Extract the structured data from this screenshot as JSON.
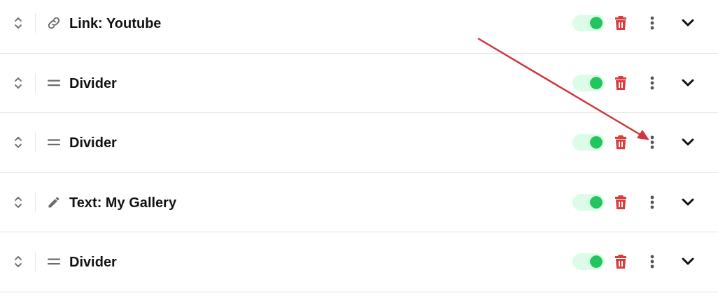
{
  "blocks": [
    {
      "kind": "link",
      "label": "Link: Youtube",
      "on": true
    },
    {
      "kind": "divider",
      "label": "Divider",
      "on": true
    },
    {
      "kind": "divider",
      "label": "Divider",
      "on": true
    },
    {
      "kind": "text",
      "label": "Text: My Gallery",
      "on": true
    },
    {
      "kind": "divider",
      "label": "Divider",
      "on": true
    }
  ]
}
